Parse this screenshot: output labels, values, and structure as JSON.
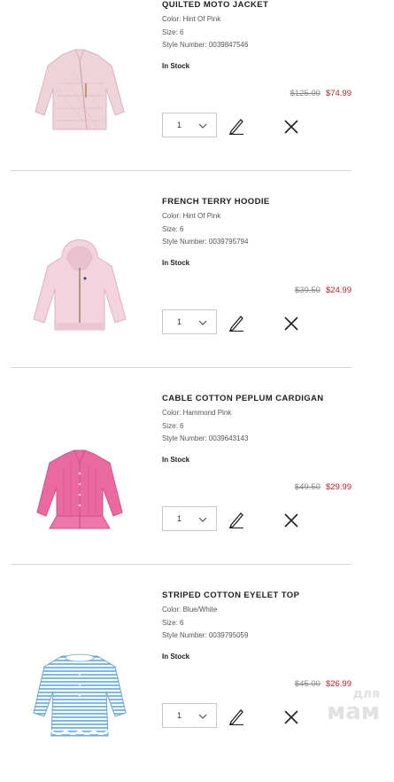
{
  "labels": {
    "color": "Color:",
    "size": "Size:",
    "style_number": "Style Number:"
  },
  "items": [
    {
      "name": "QUILTED MOTO JACKET",
      "color": "Hint Of Pink",
      "size": "6",
      "style_number": "0039847546",
      "stock": "In Stock",
      "original_price": "$125.00",
      "sale_price": "$74.99",
      "quantity": "1",
      "image_color": "#efd3da"
    },
    {
      "name": "FRENCH TERRY HOODIE",
      "color": "Hint Of Pink",
      "size": "6",
      "style_number": "0039795794",
      "stock": "In Stock",
      "original_price": "$39.50",
      "sale_price": "$24.99",
      "quantity": "1",
      "image_color": "#f2d3de"
    },
    {
      "name": "CABLE COTTON PEPLUM CARDIGAN",
      "color": "Hammond Pink",
      "size": "6",
      "style_number": "0039643143",
      "stock": "In Stock",
      "original_price": "$49.50",
      "sale_price": "$29.99",
      "quantity": "1",
      "image_color": "#ea6aa0"
    },
    {
      "name": "STRIPED COTTON EYELET TOP",
      "color": "Blue/White",
      "size": "6",
      "style_number": "0039795059",
      "stock": "In Stock",
      "original_price": "$45.00",
      "sale_price": "$26.99",
      "quantity": "1",
      "image_color": "#7fb8e6"
    }
  ],
  "watermark": {
    "line1": "для",
    "line2": "мам"
  },
  "colors": {
    "sale": "#b8202f",
    "divider": "#d6d6d6"
  }
}
